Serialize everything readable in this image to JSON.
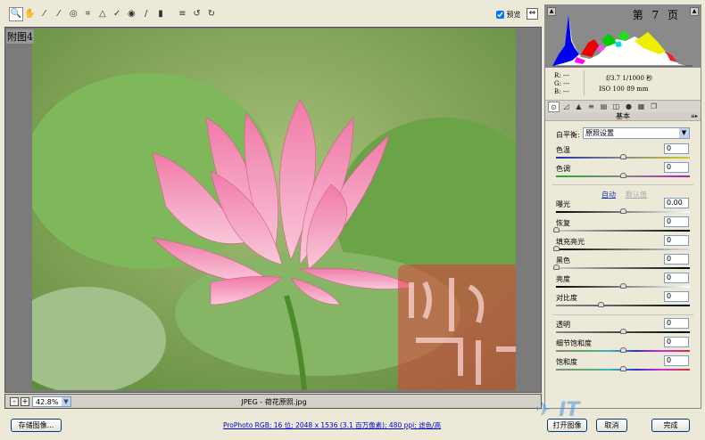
{
  "toolbar": {
    "tools": [
      {
        "name": "zoom-tool",
        "glyph": "🔍"
      },
      {
        "name": "hand-tool",
        "glyph": "✋"
      },
      {
        "name": "white-balance-tool",
        "glyph": "⁄"
      },
      {
        "name": "color-sampler-tool",
        "glyph": "⁄"
      },
      {
        "name": "target-adjust-tool",
        "glyph": "◎"
      },
      {
        "name": "crop-tool",
        "glyph": "⌗"
      },
      {
        "name": "straighten-tool",
        "glyph": "△"
      },
      {
        "name": "retouch-tool",
        "glyph": "✓"
      },
      {
        "name": "red-eye-tool",
        "glyph": "◉"
      },
      {
        "name": "adjustment-brush-tool",
        "glyph": "/"
      },
      {
        "name": "graduated-filter-tool",
        "glyph": "▮"
      },
      {
        "name": "preferences-tool",
        "glyph": "≡"
      },
      {
        "name": "rotate-left-tool",
        "glyph": "↺"
      },
      {
        "name": "rotate-right-tool",
        "glyph": "↻"
      }
    ],
    "preview_label": "预览",
    "preview_checked": true
  },
  "viewer": {
    "caption": "附图4",
    "zoom": "42.8%",
    "filename": "JPEG -  荷花原照.jpg"
  },
  "histogram": {
    "page_label": "第 7 页"
  },
  "info": {
    "r": "R:  ---",
    "g": "G:  ---",
    "b": "B:  ---",
    "aperture_shutter": "f/3.7   1/1000 秒",
    "iso_focal": "ISO 100   89 mm"
  },
  "panel": {
    "section_title": "基本",
    "white_balance_label": "白平衡:",
    "white_balance_value": "原照设置",
    "auto_label": "自动",
    "default_label": "默认值",
    "sliders": [
      {
        "label": "色温",
        "value": "0",
        "pos": 0.5,
        "track": "linear-gradient(90deg,#2233aa,#888,#cccc22)"
      },
      {
        "label": "色调",
        "value": "0",
        "pos": 0.5,
        "track": "linear-gradient(90deg,#22aa33,#888,#aa22aa)"
      },
      {
        "label": "曝光",
        "value": "0.00",
        "pos": 0.5,
        "track": "linear-gradient(90deg,#000,#fff)"
      },
      {
        "label": "恢复",
        "value": "0",
        "pos": 0,
        "track": "linear-gradient(90deg,#ccc,#000)"
      },
      {
        "label": "填充亮光",
        "value": "0",
        "pos": 0,
        "track": "linear-gradient(90deg,#000,#ddd)"
      },
      {
        "label": "黑色",
        "value": "0",
        "pos": 0,
        "track": "linear-gradient(90deg,#ccc,#000)"
      },
      {
        "label": "亮度",
        "value": "0",
        "pos": 0.5,
        "track": "linear-gradient(90deg,#000,#fff)"
      },
      {
        "label": "对比度",
        "value": "0",
        "pos": 0.33,
        "track": "linear-gradient(90deg,#888,#555,#000)"
      },
      {
        "label": "透明",
        "value": "0",
        "pos": 0.5,
        "track": "linear-gradient(90deg,#888,#444,#000)"
      },
      {
        "label": "细节饱和度",
        "value": "0",
        "pos": 0.5,
        "track": "linear-gradient(90deg,#888,#6a6,#3bb,#33c,#c3c,#c33)"
      },
      {
        "label": "饱和度",
        "value": "0",
        "pos": 0.5,
        "track": "linear-gradient(90deg,#888,#6a6,#3bb,#33c,#c3c,#c33)"
      }
    ]
  },
  "footer": {
    "save_label": "存储图像...",
    "status_link": "ProPhoto RGB; 16 位; 2048 x 1536 (3.1 百万像素); 480 ppi; 滤色/高",
    "open_label": "打开图像",
    "cancel_label": "取消",
    "done_label": "完成"
  }
}
